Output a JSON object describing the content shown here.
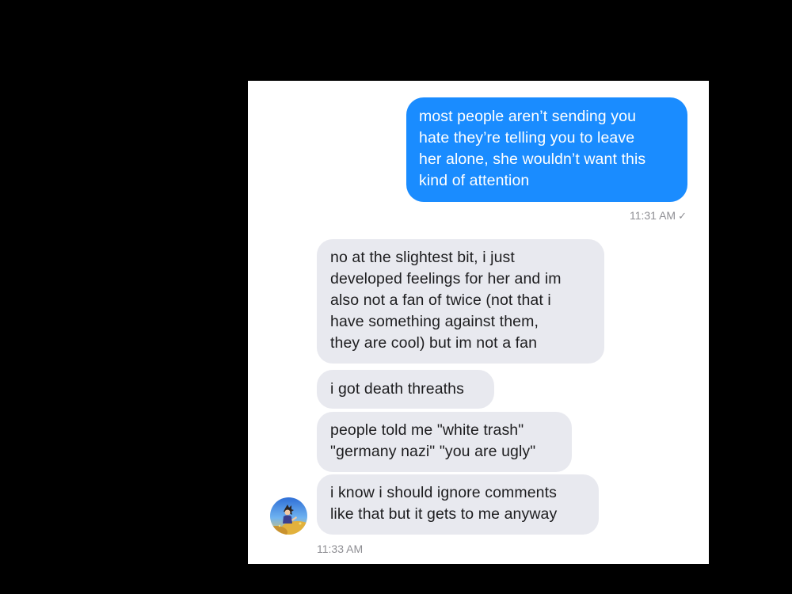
{
  "conversation": {
    "outgoing": [
      {
        "text": "most people aren’t sending you\nhate they’re telling you to leave\nher alone, she wouldn’t want this\nkind of attention",
        "time": "11:31 AM"
      }
    ],
    "incoming": [
      {
        "text": "no at the slightest bit, i just\ndeveloped feelings for her and im\nalso not a fan of twice (not that i\nhave something against them,\nthey are cool) but im not a fan"
      },
      {
        "text": "i got death threaths"
      },
      {
        "text": "people told me \"white trash\"\n\"germany nazi\" \"you are ugly\""
      },
      {
        "text": "i know i should ignore comments\nlike that but it gets to me anyway"
      }
    ],
    "incoming_time": "11:33 AM"
  },
  "icons": {
    "read_receipt": "check-icon",
    "contact_avatar": "avatar-image"
  },
  "colors": {
    "outgoing_bubble": "#1a8cff",
    "incoming_bubble": "#e8e9ef",
    "background": "#000000"
  }
}
